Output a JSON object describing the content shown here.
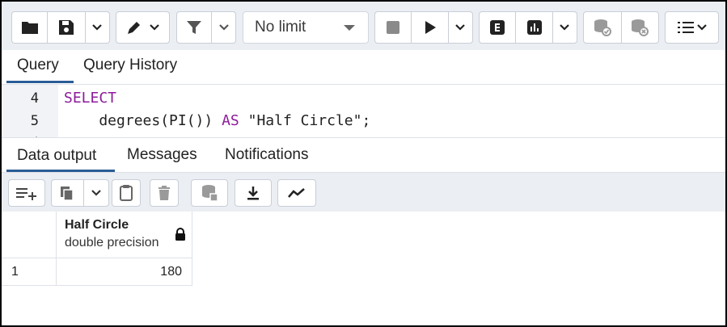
{
  "toolbar": {
    "row_limit": "No limit",
    "icons": [
      "folder-open-icon",
      "save-icon",
      "chevron-down-icon",
      "edit-pen-icon",
      "filter-icon",
      "stop-icon",
      "play-icon",
      "explain-icon",
      "explain-analyze-icon",
      "commit-icon",
      "rollback-icon",
      "macros-icon"
    ]
  },
  "query_tabs": [
    {
      "label": "Query",
      "active": true
    },
    {
      "label": "Query History",
      "active": false
    }
  ],
  "editor": {
    "lines": [
      {
        "number": "4",
        "text": "SELECT"
      },
      {
        "number": "5",
        "text": "    degrees(PI()) AS \"Half Circle\";"
      }
    ],
    "keyword_color": "#8e1b9c"
  },
  "output_tabs": [
    {
      "label": "Data output",
      "active": true
    },
    {
      "label": "Messages",
      "active": false
    },
    {
      "label": "Notifications",
      "active": false
    }
  ],
  "result_grid": {
    "columns": [
      {
        "name": "Half Circle",
        "type": "double precision",
        "locked": true
      }
    ],
    "rows": [
      {
        "row_number": "1",
        "values": [
          "180"
        ]
      }
    ]
  },
  "colors": {
    "accent": "#2a5c96",
    "toolbar_bg": "#ebeef3"
  }
}
